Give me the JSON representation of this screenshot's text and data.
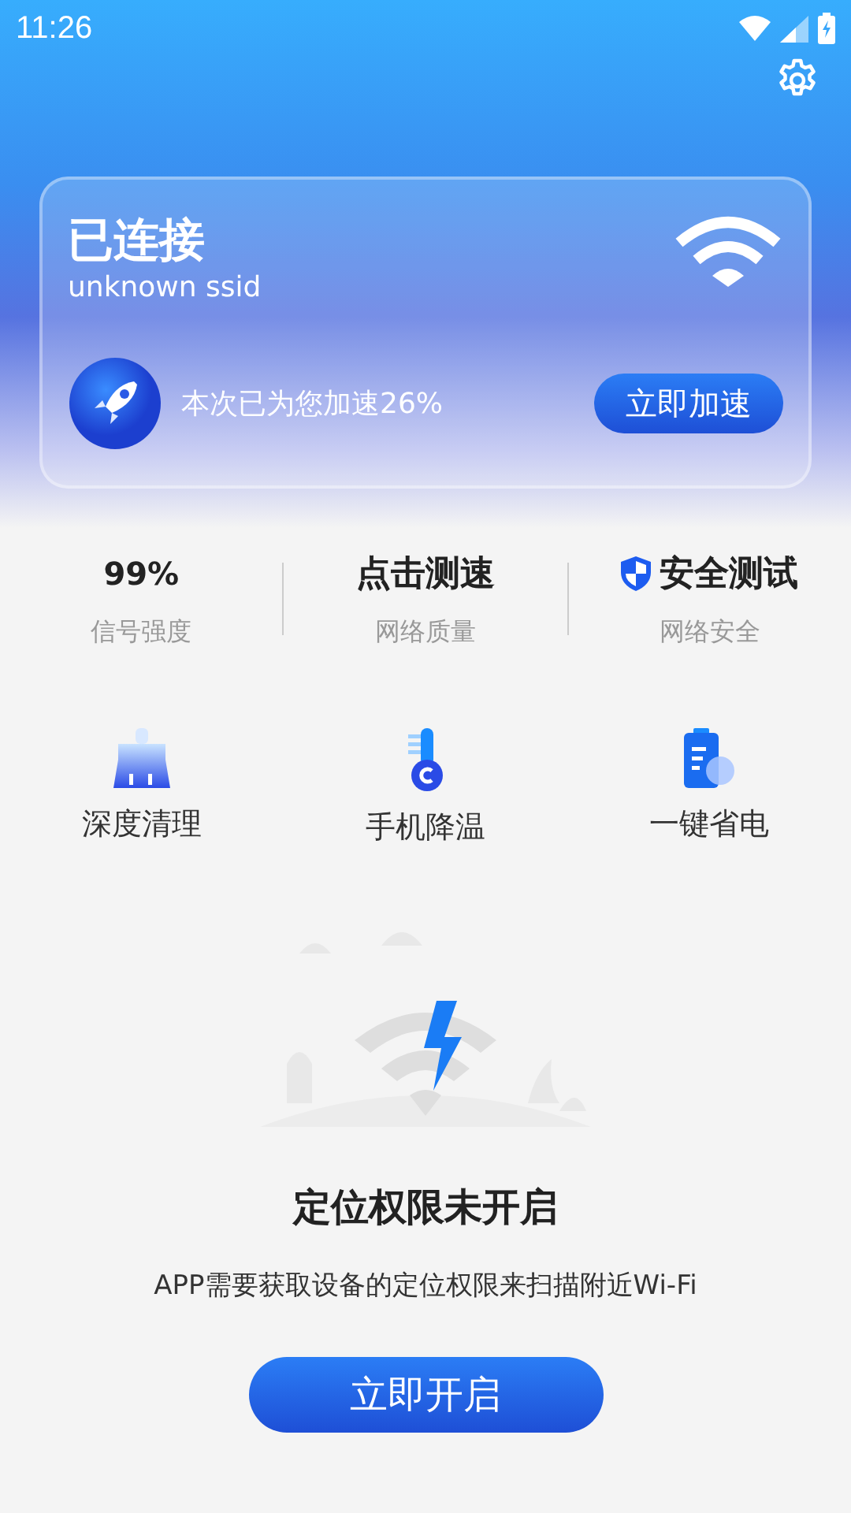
{
  "status_bar": {
    "time": "11:26"
  },
  "connection_card": {
    "status": "已连接",
    "ssid": "unknown ssid",
    "boost_text": "本次已为您加速26%",
    "boost_button": "立即加速"
  },
  "stats": [
    {
      "kind": "value",
      "value": "99%",
      "label": "信号强度"
    },
    {
      "kind": "action",
      "value": "点击测速",
      "label": "网络质量"
    },
    {
      "kind": "shield",
      "value": "安全测试",
      "label": "网络安全"
    }
  ],
  "tools": [
    {
      "kind": "broom",
      "label": "深度清理"
    },
    {
      "kind": "thermometer",
      "label": "手机降温"
    },
    {
      "kind": "battery",
      "label": "一键省电"
    }
  ],
  "permission": {
    "title": "定位权限未开启",
    "description": "APP需要获取设备的定位权限来扫描附近Wi-Fi",
    "button": "立即开启"
  }
}
